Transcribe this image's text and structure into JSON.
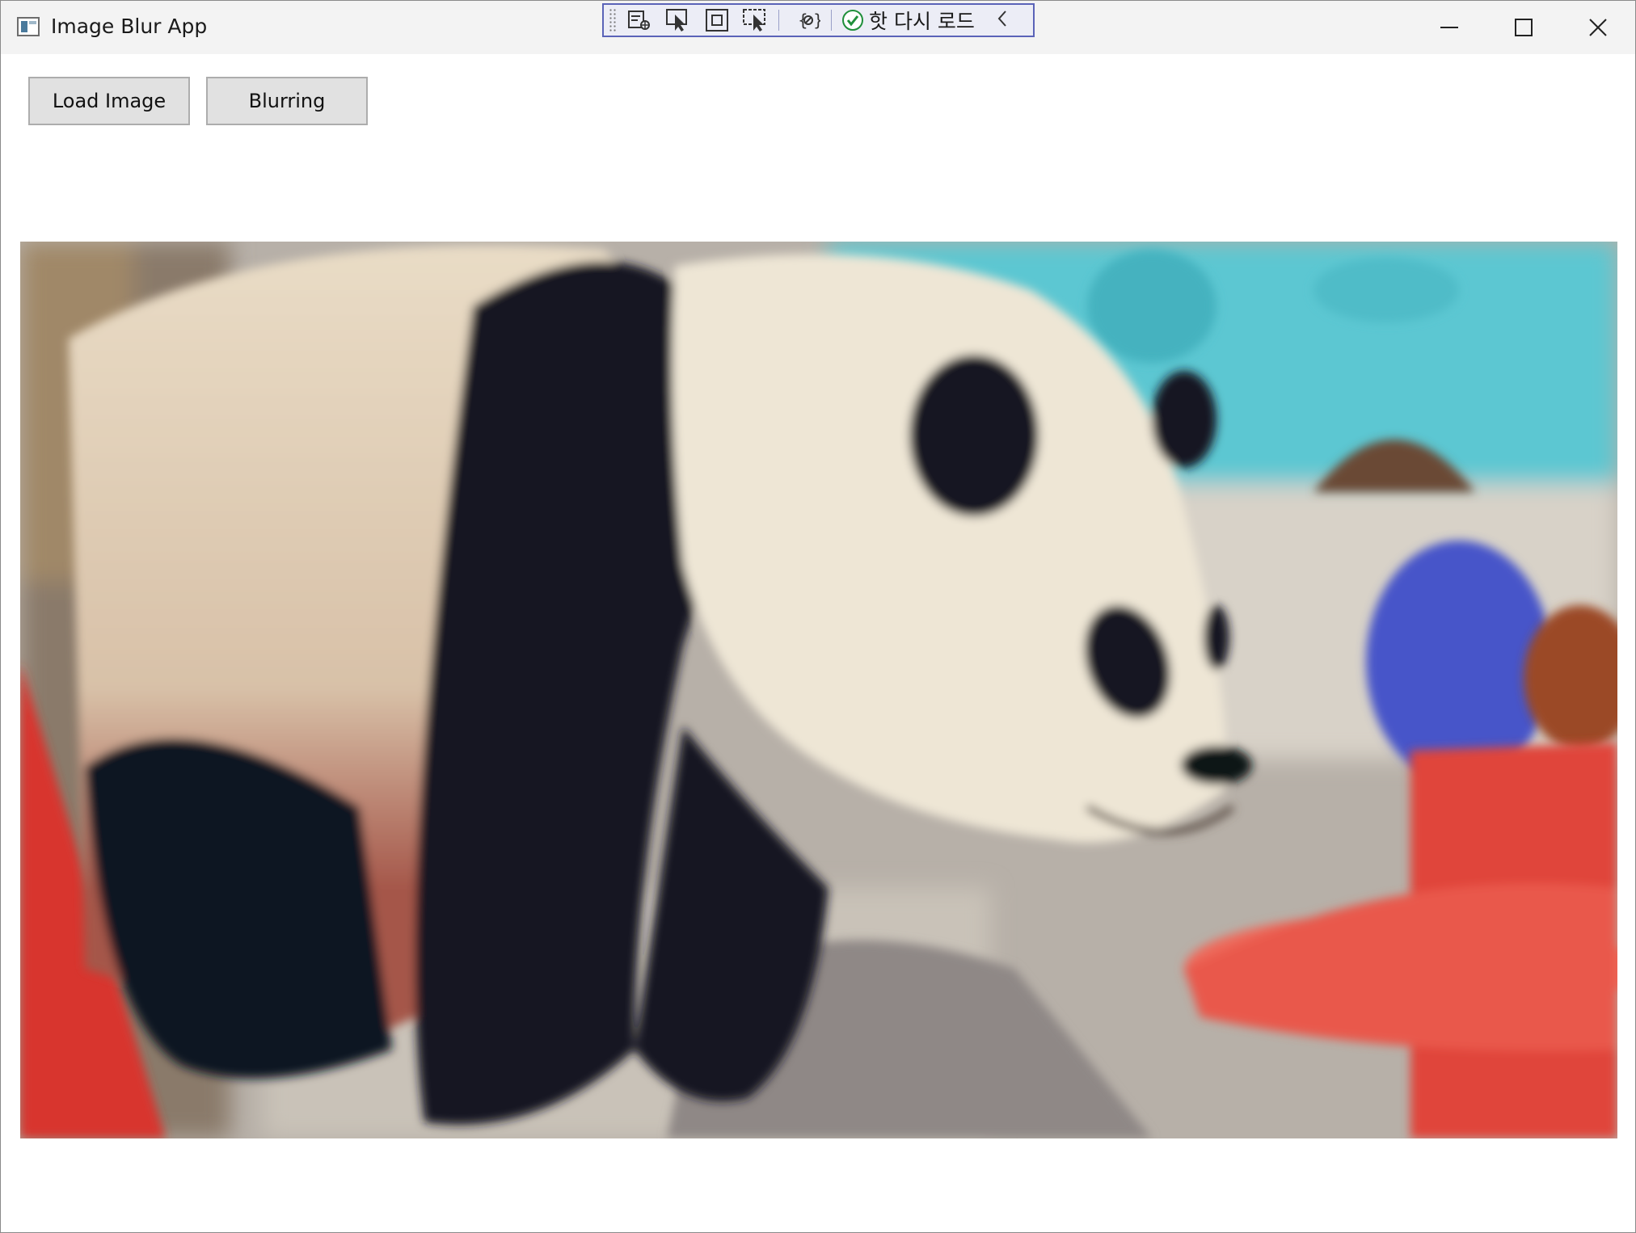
{
  "window": {
    "title": "Image Blur App"
  },
  "debug_toolbar": {
    "hot_reload_label": "핫 다시 로드"
  },
  "toolbar": {
    "load_label": "Load Image",
    "blur_label": "Blurring"
  },
  "icons": {
    "app": "app-window-icon",
    "minimize": "minimize-icon",
    "maximize": "maximize-icon",
    "close": "close-icon",
    "live_tree": "live-visual-tree-icon",
    "select_element": "select-element-icon",
    "layout_adorners": "layout-adorners-icon",
    "track_focus": "track-focus-icon",
    "binding_failures": "binding-failures-icon",
    "hot_reload_ok": "check-circle-icon",
    "collapse": "chevron-left-icon"
  },
  "colors": {
    "toolbar_border": "#5a63b8",
    "toolbar_bg": "#ecedf6",
    "button_bg": "#e1e1e1",
    "check_green": "#1f8f3a"
  }
}
